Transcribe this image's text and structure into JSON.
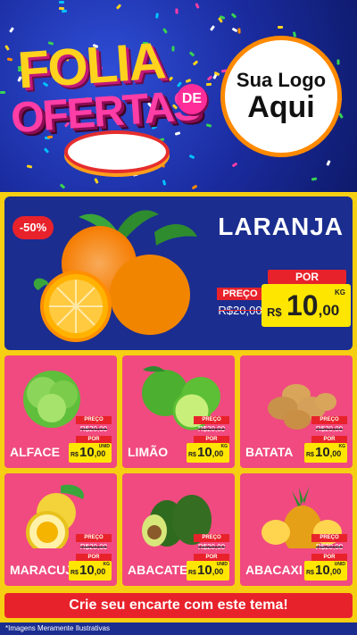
{
  "header": {
    "title_line1": "FOLIA",
    "title_de": "DE",
    "title_line2": "OFERTAS",
    "logo_line1": "Sua Logo",
    "logo_line2": "Aqui"
  },
  "featured": {
    "discount": "-50%",
    "name": "LARANJA",
    "preco_label": "PREÇO",
    "old_price": "R$20,00",
    "por_label": "POR",
    "currency": "R$",
    "price_int": "10",
    "price_cents": ",00",
    "unit": "KG"
  },
  "products": [
    {
      "name": "ALFACE",
      "preco_label": "PREÇO",
      "old_price": "R$20,00",
      "por_label": "POR",
      "currency": "R$",
      "price_int": "10",
      "price_cents": ",00",
      "unit": "UNID"
    },
    {
      "name": "LIMÃO",
      "preco_label": "PREÇO",
      "old_price": "R$20,00",
      "por_label": "POR",
      "currency": "R$",
      "price_int": "10",
      "price_cents": ",00",
      "unit": "KG"
    },
    {
      "name": "BATATA",
      "preco_label": "PREÇO",
      "old_price": "R$20,00",
      "por_label": "POR",
      "currency": "R$",
      "price_int": "10",
      "price_cents": ",00",
      "unit": "KG"
    },
    {
      "name": "MARACUJÁ",
      "preco_label": "PREÇO",
      "old_price": "R$20,00",
      "por_label": "POR",
      "currency": "R$",
      "price_int": "10",
      "price_cents": ",00",
      "unit": "KG"
    },
    {
      "name": "ABACATE",
      "preco_label": "PREÇO",
      "old_price": "R$20,00",
      "por_label": "POR",
      "currency": "R$",
      "price_int": "10",
      "price_cents": ",00",
      "unit": "UNID"
    },
    {
      "name": "ABACAXI",
      "preco_label": "PREÇO",
      "old_price": "R$20,00",
      "por_label": "POR",
      "currency": "R$",
      "price_int": "10",
      "price_cents": ",00",
      "unit": "UNID"
    }
  ],
  "footer": {
    "cta": "Crie seu encarte com este tema!",
    "disclaimer": "*Imagens Meramente Ilustrativas"
  },
  "colors": {
    "background": "#f7cf12",
    "header_blue": "#1b2d8f",
    "card_pink": "#f04a80",
    "price_yellow": "#ffe600",
    "label_red": "#e8222b"
  }
}
